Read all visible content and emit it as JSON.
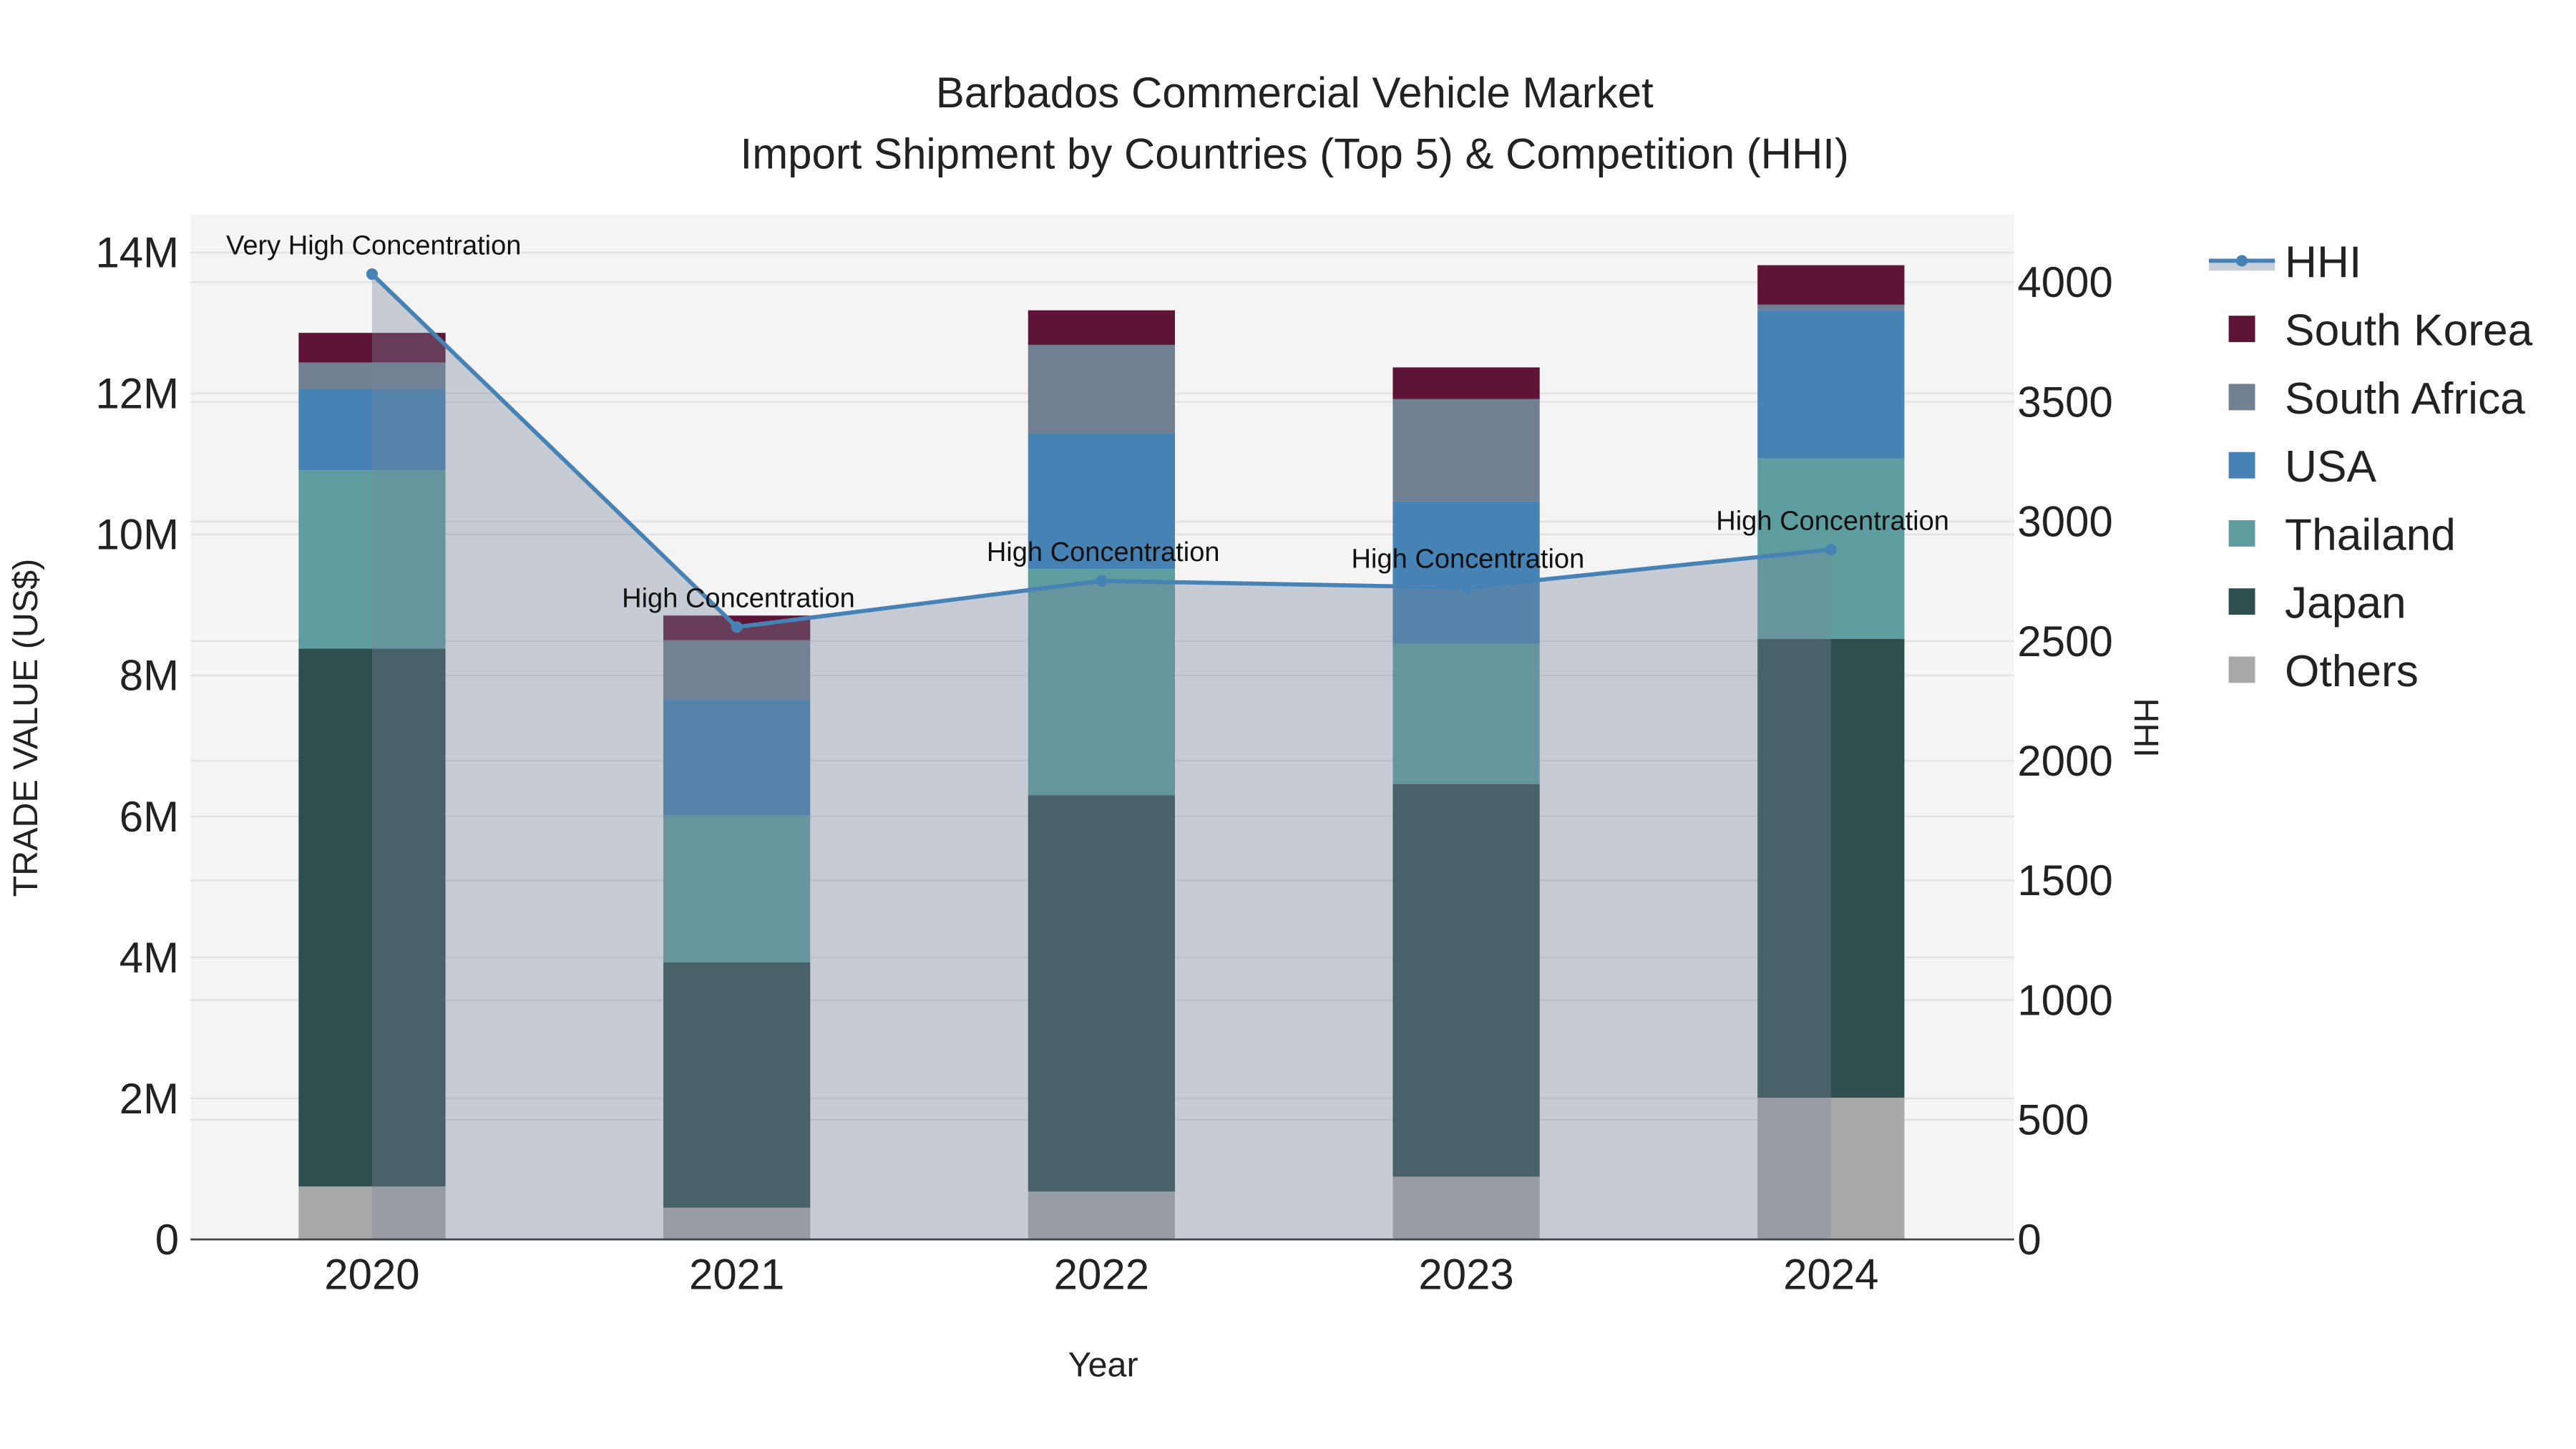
{
  "chart_data": {
    "type": "bar",
    "title": "Barbados Commercial Vehicle Market",
    "subtitle": "Import Shipment by Countries (Top 5) & Competition (HHI)",
    "xlabel": "Year",
    "ylabel": "TRADE VALUE (US$)",
    "y2label": "HHI",
    "ylim": [
      0,
      14500000
    ],
    "y2lim": [
      0,
      4250
    ],
    "grid": true,
    "legend_placement": "right",
    "categories": [
      "2020",
      "2021",
      "2022",
      "2023",
      "2024"
    ],
    "y_ticks": [
      {
        "v": 0,
        "label": "0"
      },
      {
        "v": 2000000,
        "label": "2M"
      },
      {
        "v": 4000000,
        "label": "4M"
      },
      {
        "v": 6000000,
        "label": "6M"
      },
      {
        "v": 8000000,
        "label": "8M"
      },
      {
        "v": 10000000,
        "label": "10M"
      },
      {
        "v": 12000000,
        "label": "12M"
      },
      {
        "v": 14000000,
        "label": "14M"
      }
    ],
    "y2_ticks": [
      {
        "v": 0,
        "label": "0"
      },
      {
        "v": 500,
        "label": "500"
      },
      {
        "v": 1000,
        "label": "1000"
      },
      {
        "v": 1500,
        "label": "1500"
      },
      {
        "v": 2000,
        "label": "2000"
      },
      {
        "v": 2500,
        "label": "2500"
      },
      {
        "v": 3000,
        "label": "3000"
      },
      {
        "v": 3500,
        "label": "3500"
      },
      {
        "v": 4000,
        "label": "4000"
      }
    ],
    "series": [
      {
        "name": "Others",
        "color": "#a9a9a9",
        "values": [
          750000,
          450000,
          680000,
          890000,
          2010000
        ]
      },
      {
        "name": "Japan",
        "color": "#2f4f4f",
        "values": [
          7630000,
          3480000,
          5620000,
          5570000,
          6510000
        ]
      },
      {
        "name": "Thailand",
        "color": "#5f9ea0",
        "values": [
          2530000,
          2090000,
          3210000,
          1990000,
          2560000
        ]
      },
      {
        "name": "USA",
        "color": "#4682b4",
        "values": [
          1150000,
          1640000,
          1920000,
          2020000,
          2100000
        ]
      },
      {
        "name": "South Africa",
        "color": "#708090",
        "values": [
          380000,
          840000,
          1260000,
          1450000,
          80000
        ]
      },
      {
        "name": "South Korea",
        "color": "#5e1434",
        "values": [
          420000,
          350000,
          490000,
          450000,
          560000
        ]
      }
    ],
    "hhi": {
      "name": "HHI",
      "color": "#4682b4",
      "values": [
        4034,
        2559,
        2752,
        2724,
        2883
      ],
      "annotations": [
        "Very High Concentration",
        "High Concentration",
        "High Concentration",
        "High Concentration",
        "High Concentration"
      ]
    },
    "legend_order": [
      "HHI",
      "South Korea",
      "South Africa",
      "USA",
      "Thailand",
      "Japan",
      "Others"
    ]
  }
}
